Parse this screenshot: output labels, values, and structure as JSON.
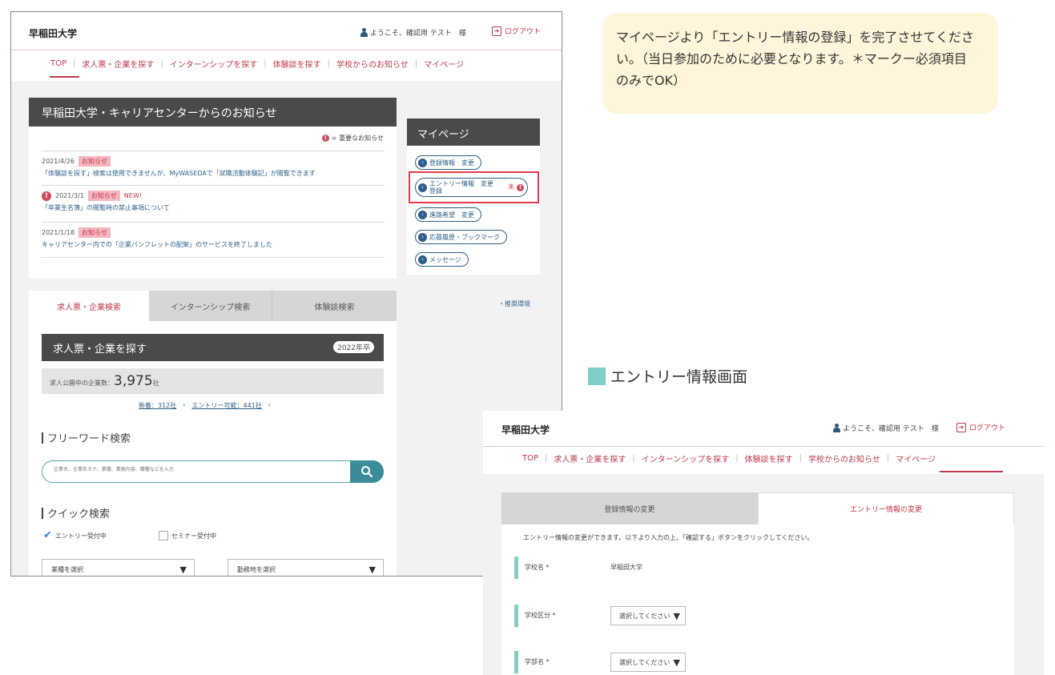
{
  "site": {
    "logo": "早稲田大学",
    "welcome": "ようこそ、確認用 テスト　様",
    "logout": "ログアウト"
  },
  "nav": [
    "TOP",
    "求人票・企業を探す",
    "インターンシップを探す",
    "体験談を探す",
    "学校からのお知らせ",
    "マイページ"
  ],
  "news": {
    "title": "早稲田大学・キャリアセンターからのお知らせ",
    "legend": "= 重要なお知らせ",
    "items": [
      {
        "date": "2021/4/26",
        "badge": "お知らせ",
        "new": "",
        "text": "「体験談を探す」検索は使用できませんが、MyWASEDAで「就職活動体験記」が閲覧できます",
        "important": false
      },
      {
        "date": "2021/3/1",
        "badge": "お知らせ",
        "new": "NEW!",
        "text": "「卒業生名簿」の閲覧時の禁止事項について",
        "important": true
      },
      {
        "date": "2021/1/18",
        "badge": "お知らせ",
        "new": "",
        "text": "キャリアセンター内での「企業パンフレットの配架」のサービスを終了しました",
        "important": false
      }
    ]
  },
  "mypage": {
    "title": "マイページ",
    "links": [
      "登録情報　変更",
      "進路希望　変更",
      "応募履歴・ブックマーク",
      "メッセージ"
    ],
    "entry_label": "エントリー情報　変更",
    "entry_label_line2": "登録",
    "entry_status": "未"
  },
  "search_tabs": [
    "求人票・企業検索",
    "インターンシップ検索",
    "体験談検索"
  ],
  "recommended_env": "・推奨環境",
  "search": {
    "title": "求人票・企業を探す",
    "year_badge": "2022年卒",
    "count_label": "求人公開中の企業数：",
    "count_value": "3,975",
    "count_unit": "社",
    "link_new": "新着：312社",
    "link_entry": "エントリー可能：441社",
    "freeword_title": "フリーワード検索",
    "freeword_placeholder": "企業名、企業名カナ、業種、業務内容、職種などを入力",
    "quick_title": "クイック検索",
    "check_entry": "エントリー受付中",
    "check_seminar": "セミナー受付中",
    "select_industry": "業種を選択",
    "select_location": "勤務地を選択"
  },
  "callout": {
    "text": "マイページより「エントリー情報の登録」を完了させてください。（当日参加のために必要となります。＊マークー必須項目のみでOK）"
  },
  "section_label": "エントリー情報画面",
  "entry_screen": {
    "tabs": [
      "登録情報の変更",
      "エントリー情報の変更"
    ],
    "intro": "エントリー情報の変更ができます。以下より入力の上、「確認する」ボタンをクリックしてください。",
    "school_label": "学校名 *",
    "school_value": "早稲田大学",
    "division_label": "学校区分 *",
    "division_value": "選択してください",
    "faculty_label": "学部名 *",
    "faculty_value": "選択してください"
  },
  "colors": {
    "accent_red": "#c0394b",
    "teal": "#7ecfc6",
    "dark_header": "#4a4a4a",
    "callout_bg": "#fff5da"
  }
}
